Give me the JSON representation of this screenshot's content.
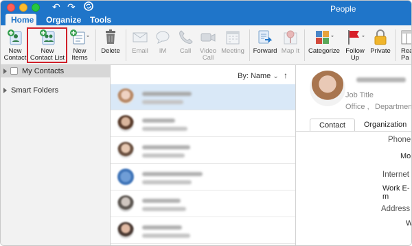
{
  "window": {
    "title": "People"
  },
  "tabs": [
    {
      "label": "Home"
    },
    {
      "label": "Organize"
    },
    {
      "label": "Tools"
    }
  ],
  "ribbon": {
    "new_contact": {
      "line1": "New",
      "line2": "Contact"
    },
    "new_contact_list": {
      "line1": "New",
      "line2": "Contact List"
    },
    "new_items": {
      "line1": "New",
      "line2": "Items"
    },
    "delete": {
      "line1": "Delete"
    },
    "email": {
      "line1": "Email"
    },
    "im": {
      "line1": "IM"
    },
    "call": {
      "line1": "Call"
    },
    "video_call": {
      "line1": "Video",
      "line2": "Call"
    },
    "meeting": {
      "line1": "Meeting"
    },
    "forward": {
      "line1": "Forward"
    },
    "map_it": {
      "line1": "Map It"
    },
    "categorize": {
      "line1": "Categorize"
    },
    "follow_up": {
      "line1": "Follow",
      "line2": "Up"
    },
    "private": {
      "line1": "Private"
    },
    "read_pane": {
      "line1": "Rea",
      "line2": "Pa"
    }
  },
  "nav": {
    "my_contacts": "My Contacts",
    "smart_folders": "Smart Folders"
  },
  "list": {
    "sort_label": "By: Name",
    "sort_chevron": "⌄",
    "sort_arrow": "↑"
  },
  "detail": {
    "job_title": "Job Title",
    "office": "Office ,",
    "department": "Department",
    "tabs": [
      "Contact",
      "Organization"
    ],
    "phone_label": "Phone",
    "phone_value": "Mo",
    "internet_label": "Internet",
    "internet_value": "Work E-m",
    "address_label": "Address",
    "address_value": "W"
  },
  "colors": {
    "titlebar": "#1f75c9",
    "highlight_box": "#d0202a",
    "selected_row": "#d9e8f7"
  }
}
